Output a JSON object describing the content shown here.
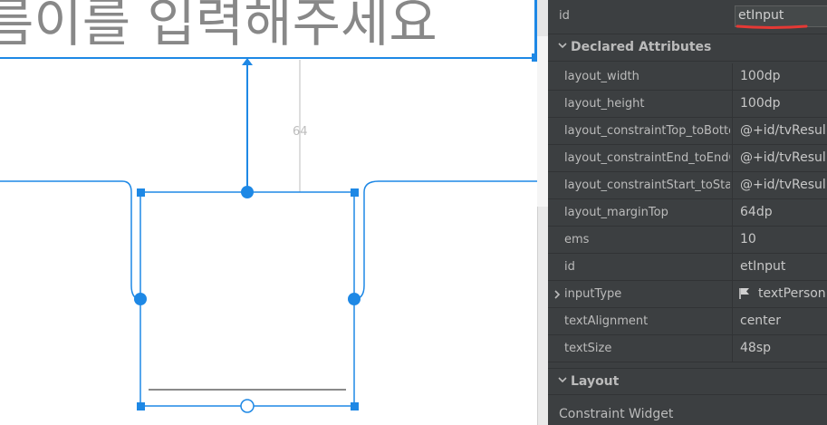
{
  "canvas": {
    "hint_text": "름이를 입력해주세요",
    "margin_value": "64"
  },
  "panel": {
    "id_row": {
      "label": "id",
      "value": "etInput"
    },
    "declared_section_title": "Declared Attributes",
    "attributes": [
      {
        "name": "layout_width",
        "value": "100dp"
      },
      {
        "name": "layout_height",
        "value": "100dp"
      },
      {
        "name": "layout_constraintTop_toBotto...",
        "value": "@+id/tvResul"
      },
      {
        "name": "layout_constraintEnd_toEndOf",
        "value": "@+id/tvResul"
      },
      {
        "name": "layout_constraintStart_toStart...",
        "value": "@+id/tvResul"
      },
      {
        "name": "layout_marginTop",
        "value": "64dp"
      },
      {
        "name": "ems",
        "value": "10"
      },
      {
        "name": "id",
        "value": "etInput"
      },
      {
        "name": "inputType",
        "value": "textPersonN"
      },
      {
        "name": "textAlignment",
        "value": "center"
      },
      {
        "name": "textSize",
        "value": "48sp"
      }
    ],
    "layout_section_title": "Layout",
    "constraint_widget_label": "Constraint Widget"
  },
  "colors": {
    "selection_blue": "#1e88e5",
    "panel_bg": "#3c3f41",
    "annotation_red": "#e53935"
  },
  "icons": {
    "section_expanded": "chevron-down-icon",
    "row_collapsed": "chevron-right-icon",
    "input_type": "flag-icon"
  }
}
